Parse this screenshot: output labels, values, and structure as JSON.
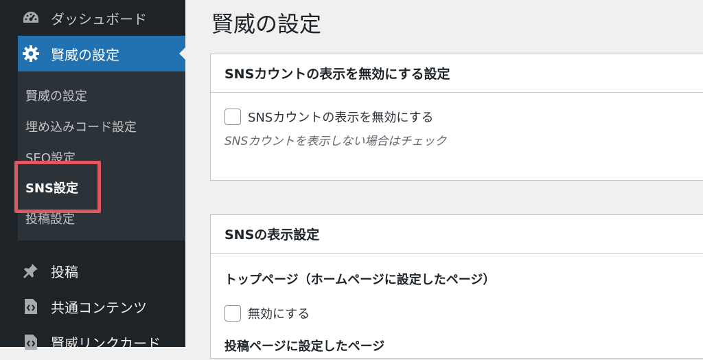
{
  "sidebar": {
    "dashboard": {
      "label": "ダッシュボード",
      "icon": "dashboard-icon"
    },
    "kenjo_settings": {
      "label": "賢威の設定",
      "icon": "gear-icon"
    },
    "submenu": [
      {
        "label": "賢威の設定"
      },
      {
        "label": "埋め込みコード設定"
      },
      {
        "label": "SEO設定"
      },
      {
        "label": "SNS設定",
        "active": true
      },
      {
        "label": "投稿設定"
      }
    ],
    "posts": {
      "label": "投稿",
      "icon": "pin-icon"
    },
    "common_content": {
      "label": "共通コンテンツ",
      "icon": "code-file-icon"
    },
    "link_card": {
      "label": "賢威リンクカード",
      "icon": "code-file-icon"
    }
  },
  "main": {
    "title": "賢威の設定",
    "card1": {
      "heading": "SNSカウントの表示を無効にする設定",
      "checkbox_label": "SNSカウントの表示を無効にする",
      "description": "SNSカウントを表示しない場合はチェック"
    },
    "card2": {
      "heading": "SNSの表示設定",
      "section1": "トップページ（ホームページに設定したページ）",
      "checkbox_label": "無効にする",
      "section2": "投稿ページに設定したページ"
    }
  },
  "colors": {
    "sidebar_bg": "#1d2327",
    "submenu_bg": "#2c3338",
    "accent": "#2271b1",
    "highlight": "#e05760"
  }
}
